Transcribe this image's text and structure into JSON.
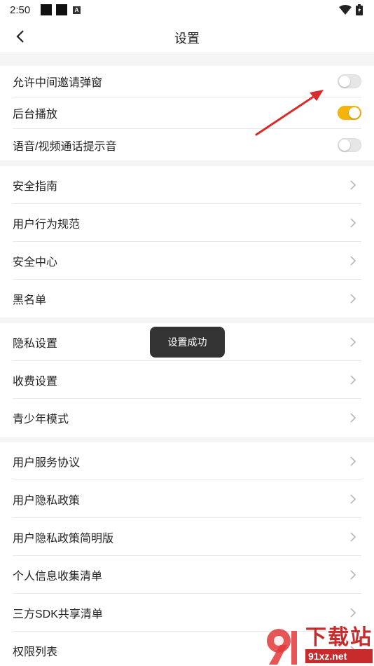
{
  "status_bar": {
    "time": "2:50",
    "badge": "A"
  },
  "header": {
    "title": "设置"
  },
  "toggles": [
    {
      "label": "允许中间邀请弹窗",
      "on": false
    },
    {
      "label": "后台播放",
      "on": true
    },
    {
      "label": "语音/视频通话提示音",
      "on": false
    }
  ],
  "groups": [
    {
      "items": [
        "安全指南",
        "用户行为规范",
        "安全中心",
        "黑名单"
      ]
    },
    {
      "items": [
        "隐私设置",
        "收费设置",
        "青少年模式"
      ]
    },
    {
      "items": [
        "用户服务协议",
        "用户隐私政策",
        "用户隐私政策简明版",
        "个人信息收集清单",
        "三方SDK共享清单",
        "权限列表"
      ]
    }
  ],
  "toast": {
    "text": "设置成功"
  },
  "watermark": {
    "main": "下载站",
    "sub": "91xz.net",
    "mark": "9"
  },
  "colors": {
    "accent": "#f5b40b",
    "arrow": "#d92b2b"
  }
}
